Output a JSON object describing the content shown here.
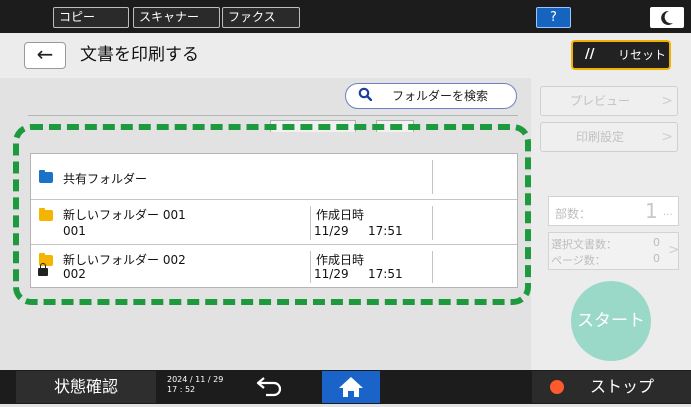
{
  "topbar": {
    "tabs": [
      {
        "label": "コピー"
      },
      {
        "label": "スキャナー"
      },
      {
        "label": "ファクス"
      }
    ],
    "help_label": "?",
    "moon_icon": "night-mode-icon"
  },
  "header": {
    "back_icon": "←",
    "title": "文書を印刷する",
    "reset_label": "リセット",
    "reset_icon": "//"
  },
  "search": {
    "label": "フォルダーを検索",
    "icon": "search-icon"
  },
  "folders": [
    {
      "name": "共有フォルダー",
      "number": "",
      "created_label": "",
      "date": "",
      "time": "",
      "locked": false,
      "color": "#1a73c9"
    },
    {
      "name": "新しいフォルダー 001",
      "number": "001",
      "created_label": "作成日時",
      "date": "11/29",
      "time": "17:51",
      "locked": false,
      "color": "#f4b400"
    },
    {
      "name": "新しいフォルダー 002",
      "number": "002",
      "created_label": "作成日時",
      "date": "11/29",
      "time": "17:51",
      "locked": true,
      "color": "#f4b400"
    }
  ],
  "right_panel": {
    "preview_label": "プレビュー",
    "print_settings_label": "印刷設定",
    "copies_label": "部数：",
    "copies_value": "1",
    "copies_suffix": "...",
    "selected_docs_label": "選択文書数：",
    "selected_docs_value": "0",
    "pages_label": "ページ数：",
    "pages_value": "0",
    "start_label": "スタート"
  },
  "bottombar": {
    "status_label": "状態確認",
    "clock_date": "2024 / 11 / 29",
    "clock_time": "17 : 52",
    "stop_label": "ストップ"
  },
  "colors": {
    "accent_green": "#1e9a3e",
    "reset_border": "#f2b300",
    "home_blue": "#1a63c9",
    "start_teal": "#9ad9c8",
    "stop_red": "#ff5a2e"
  }
}
